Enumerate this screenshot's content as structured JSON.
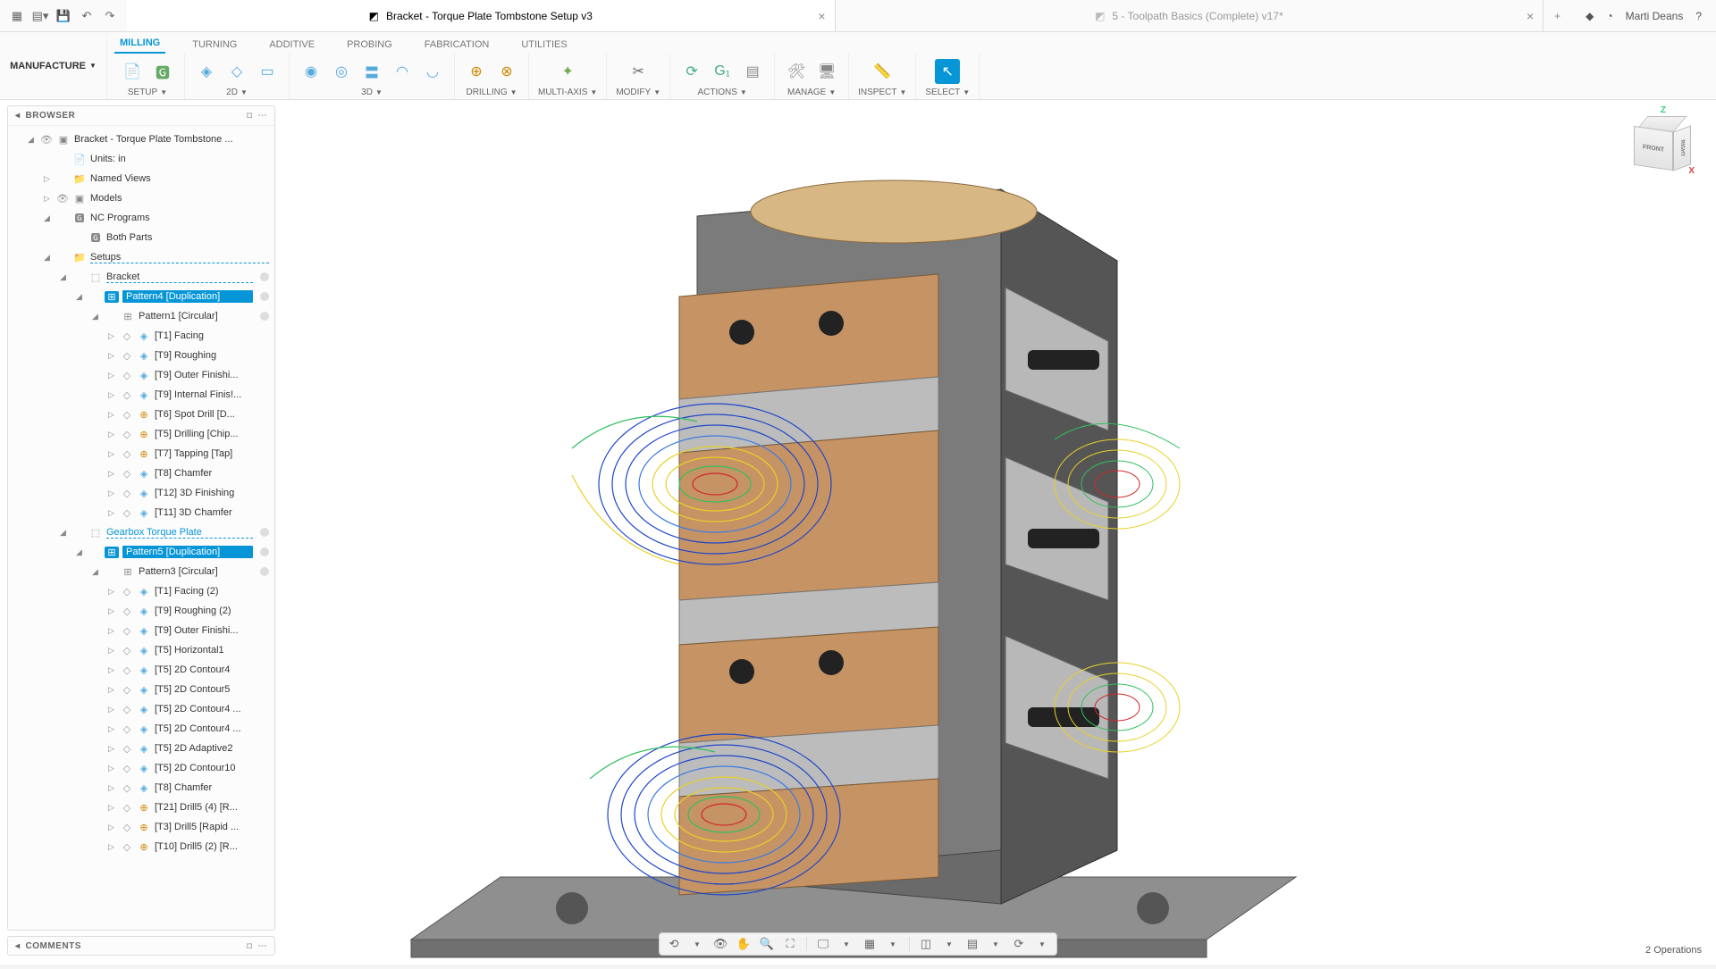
{
  "topbar": {
    "user": "Marti Deans"
  },
  "tabs": [
    {
      "title": "Bracket - Torque Plate Tombstone Setup v3",
      "active": true
    },
    {
      "title": "5 - Toolpath Basics (Complete) v17*",
      "active": false
    }
  ],
  "workspace": "MANUFACTURE",
  "ribbon_tabs": [
    "MILLING",
    "TURNING",
    "ADDITIVE",
    "PROBING",
    "FABRICATION",
    "UTILITIES"
  ],
  "ribbon_active": "MILLING",
  "groups": {
    "setup": "SETUP",
    "d2": "2D",
    "d3": "3D",
    "drill": "DRILLING",
    "multi": "MULTI-AXIS",
    "modify": "MODIFY",
    "actions": "ACTIONS",
    "manage": "MANAGE",
    "inspect": "INSPECT",
    "select": "SELECT"
  },
  "browser": {
    "title": "BROWSER",
    "root": "Bracket - Torque Plate Tombstone ...",
    "units": "Units: in",
    "named_views": "Named Views",
    "models": "Models",
    "nc_programs": "NC Programs",
    "both_parts": "Both Parts",
    "setups": "Setups",
    "bracket": "Bracket",
    "pattern4": "Pattern4 [Duplication]",
    "pattern1": "Pattern1 [Circular]",
    "ops1": [
      "[T1] Facing",
      "[T9] Roughing",
      "[T9] Outer Finishi...",
      "[T9] Internal Finis!...",
      "[T6] Spot Drill [D...",
      "[T5] Drilling [Chip...",
      "[T7] Tapping [Tap]",
      "[T8] Chamfer",
      "[T12] 3D Finishing",
      "[T11] 3D Chamfer"
    ],
    "gearbox": "Gearbox Torque Plate",
    "pattern5": "Pattern5 [Duplication]",
    "pattern3": "Pattern3 [Circular]",
    "ops2": [
      "[T1] Facing (2)",
      "[T9] Roughing (2)",
      "[T9] Outer Finishi...",
      "[T5] Horizontal1",
      "[T5] 2D Contour4",
      "[T5] 2D Contour5",
      "[T5] 2D Contour4 ...",
      "[T5] 2D Contour4 ...",
      "[T5] 2D Adaptive2",
      "[T5] 2D Contour10",
      "[T8] Chamfer",
      "[T21] Drill5 (4) [R...",
      "[T3] Drill5 [Rapid ...",
      "[T10] Drill5 (2) [R..."
    ]
  },
  "comments": "COMMENTS",
  "viewcube": {
    "front": "FRONT",
    "right": "RIGHT",
    "z": "Z",
    "x": "X"
  },
  "status": "2 Operations"
}
